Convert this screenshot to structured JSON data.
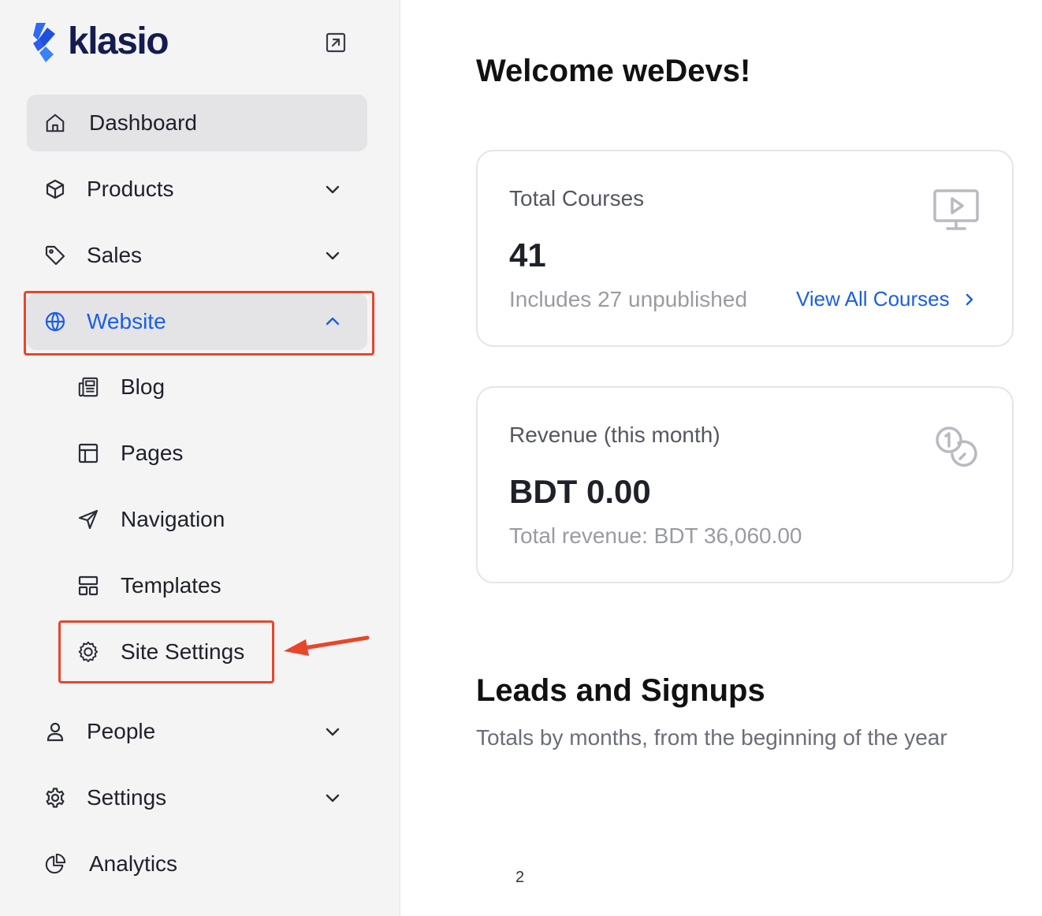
{
  "app": {
    "logo_text": "klasio",
    "brand_color": "#1a5fe6",
    "highlight_color": "#e8462b"
  },
  "sidebar": {
    "collapse_icon": "arrow-up-right-square-icon",
    "items": [
      {
        "label": "Dashboard",
        "icon": "home-icon",
        "active": true
      },
      {
        "label": "Products",
        "icon": "box-icon",
        "chevron": "down"
      },
      {
        "label": "Sales",
        "icon": "tag-icon",
        "chevron": "down"
      },
      {
        "label": "Website",
        "icon": "globe-icon",
        "chevron": "up",
        "open": true
      },
      {
        "label": "People",
        "icon": "user-icon",
        "chevron": "down"
      },
      {
        "label": "Settings",
        "icon": "gear-icon",
        "chevron": "down"
      },
      {
        "label": "Analytics",
        "icon": "pie-chart-icon"
      }
    ],
    "website_sub": [
      {
        "label": "Blog",
        "icon": "newspaper-icon"
      },
      {
        "label": "Pages",
        "icon": "layout-icon"
      },
      {
        "label": "Navigation",
        "icon": "navigation-arrow-icon"
      },
      {
        "label": "Templates",
        "icon": "template-icon"
      },
      {
        "label": "Site Settings",
        "icon": "cog-icon"
      }
    ]
  },
  "main": {
    "welcome": "Welcome weDevs!",
    "courses_card": {
      "title": "Total Courses",
      "value": "41",
      "sub": "Includes 27 unpublished",
      "link": "View All Courses",
      "icon": "monitor-play-icon"
    },
    "revenue_card": {
      "title": "Revenue (this month)",
      "value": "BDT 0.00",
      "sub": "Total revenue: BDT 36,060.00",
      "icon": "coins-icon"
    },
    "leads": {
      "title": "Leads and Signups",
      "subtitle": "Totals by months, from the beginning of the year",
      "axis_tick": "2"
    }
  }
}
